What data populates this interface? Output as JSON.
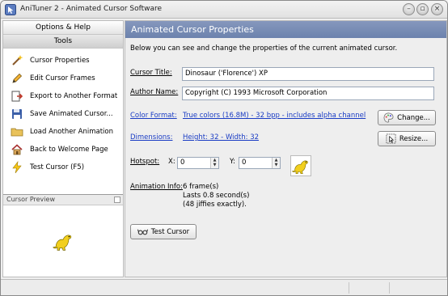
{
  "window": {
    "title": "AniTuner 2 - Animated Cursor Software",
    "icons": {
      "app": "app-icon",
      "min": "minimize-icon",
      "max": "maximize-icon",
      "close": "close-icon"
    },
    "controls": {
      "min": "–",
      "max": "▫",
      "close": "×"
    }
  },
  "sidebar": {
    "options_header": "Options & Help",
    "tools_header": "Tools",
    "items": [
      {
        "label": "Cursor Properties",
        "icon": "wand-icon"
      },
      {
        "label": "Edit Cursor Frames",
        "icon": "pencil-icon"
      },
      {
        "label": "Export to Another Format",
        "icon": "export-icon"
      },
      {
        "label": "Save Animated Cursor...",
        "icon": "save-icon"
      },
      {
        "label": "Load Another Animation",
        "icon": "load-icon"
      },
      {
        "label": "Back to Welcome Page",
        "icon": "home-icon"
      },
      {
        "label": "Test Cursor (F5)",
        "icon": "lightning-icon"
      }
    ],
    "preview_title": "Cursor Preview"
  },
  "panel": {
    "title": "Animated Cursor Properties",
    "description": "Below you can see and change the properties of the current animated cursor.",
    "cursor_title_label": "Cursor Title:",
    "cursor_title_value": "Dinosaur ('Florence') XP",
    "author_label": "Author Name:",
    "author_value": "Copyright (C) 1993 Microsoft Corporation",
    "color_format_label": "Color Format:",
    "color_format_value": "True colors (16.8M) - 32 bpp - includes alpha channel",
    "change_button": "Change...",
    "dimensions_label": "Dimensions:",
    "dimensions_value": "Height: 32 - Width: 32",
    "resize_button": "Resize...",
    "hotspot_label": "Hotspot:",
    "hotspot_x_label": "X:",
    "hotspot_x_value": "0",
    "hotspot_y_label": "Y:",
    "hotspot_y_value": "0",
    "animation_info_label": "Animation Info:",
    "animation_info_lines": [
      "6 frame(s)",
      "Lasts 0.8 second(s)",
      "(48 jiffies exactly)."
    ],
    "test_button": "Test Cursor"
  },
  "colors": {
    "panel_title_bg": "#7a8fb8",
    "link": "#1a3cc4",
    "dino": "#f0c419"
  }
}
